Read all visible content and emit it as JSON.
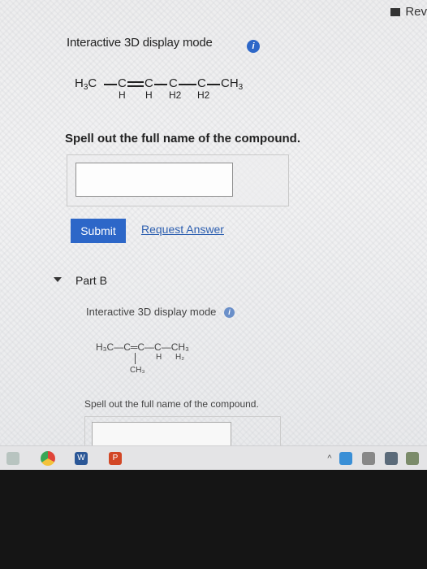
{
  "header": {
    "rev_label": "Rev"
  },
  "part_a": {
    "display_mode_label": "Interactive 3D display mode",
    "info_icon": "i",
    "formula": {
      "main": [
        "H",
        "C",
        "C",
        "C",
        "C",
        "C",
        "CH"
      ],
      "subs": [
        "3",
        "H",
        "H",
        "H2",
        "H2",
        "3"
      ]
    },
    "prompt": "Spell out the full name of the compound.",
    "input_value": "",
    "submit_label": "Submit",
    "request_label": "Request Answer"
  },
  "part_b": {
    "label": "Part B",
    "display_mode_label": "Interactive 3D display mode",
    "info_icon": "i",
    "formula": {
      "chain": "H₃C—C═C—C—CH₃",
      "branch": "CH₃",
      "subs": [
        "H",
        "H₂"
      ]
    },
    "prompt": "Spell out the full name of the compound."
  },
  "taskbar": {
    "icons": [
      "file-icon",
      "chrome-icon",
      "word-icon",
      "powerpoint-icon",
      "up-arrow-icon",
      "network-icon",
      "volume-icon",
      "cloud-icon",
      "notification-icon"
    ],
    "word_letter": "W",
    "ppt_letter": "P"
  },
  "colors": {
    "accent": "#2d67c8",
    "link": "#2d5fb0"
  }
}
